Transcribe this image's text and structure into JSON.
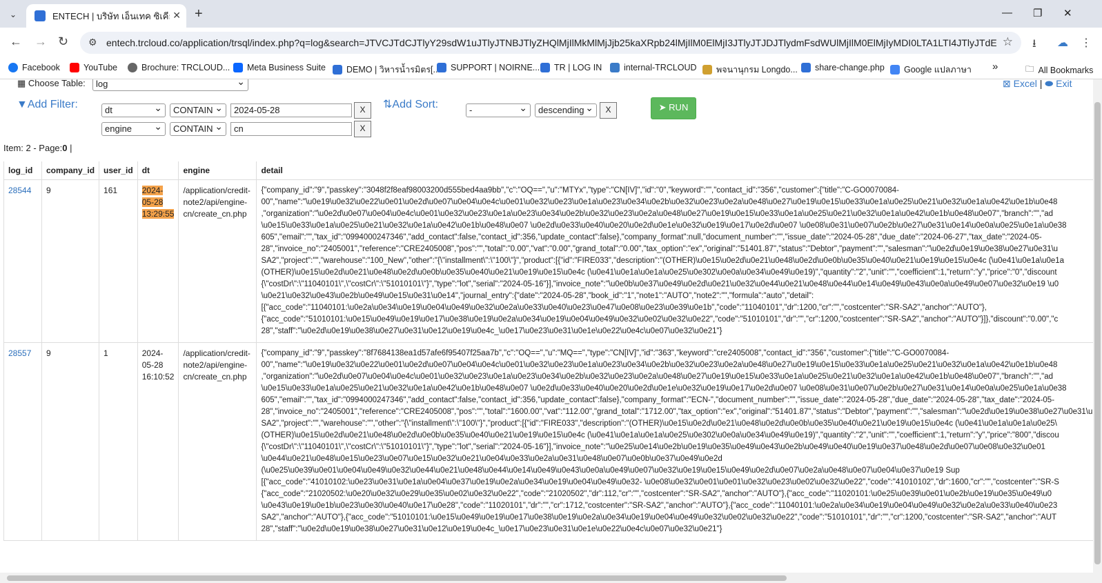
{
  "browser": {
    "tab_title": "ENTECH | บริษัท เอ็นเทค ซิเคียวริตี้",
    "url": "entech.trcloud.co/application/trsql/index.php?q=log&search=JTVCJTdCJTlyY29sdW1uJTlyJTNBJTlyZHQlMjIlMkMlMjJjb25kaXRpb24lMjIlM0ElMjI3JTlyJTJDJTlydmFsdWUlMjIlM0ElMjIyMDI0LTA1LTI4JTlyJTdEJTJD..."
  },
  "bookmarks": [
    {
      "label": "Facebook",
      "color": "#1877f2"
    },
    {
      "label": "YouTube",
      "color": "#ff0000"
    },
    {
      "label": "Brochure: TRCLOUD...",
      "color": "#555555"
    },
    {
      "label": "Meta Business Suite",
      "color": "#0a66ff"
    },
    {
      "label": "DEMO | วิหารน้ำรมิตร[...",
      "color": "#2f6fd6"
    },
    {
      "label": "SUPPORT | NOIRNE...",
      "color": "#2f6fd6"
    },
    {
      "label": "TR | LOG IN",
      "color": "#2f6fd6"
    },
    {
      "label": "internal-TRCLOUD",
      "color": "#3a7bc8"
    },
    {
      "label": "พจนานุกรม Longdo...",
      "color": "#d0a030"
    },
    {
      "label": "share-change.php",
      "color": "#2f6fd6"
    },
    {
      "label": "Google แปลภาษา",
      "color": "#4285f4"
    },
    {
      "label": "»",
      "color": ""
    },
    {
      "label": "All Bookmarks",
      "color": ""
    }
  ],
  "query": {
    "choose_table_label": "Choose Table:",
    "table_value": "log",
    "add_filter_label": "Add Filter:",
    "filters": [
      {
        "column": "dt",
        "op": "CONTAIN",
        "value": "2024-05-28",
        "remove": "X"
      },
      {
        "column": "engine",
        "op": "CONTAIN",
        "value": "cn",
        "remove": "X"
      }
    ],
    "add_sort_label": "Add Sort:",
    "sort": {
      "column": "-",
      "direction": "descending",
      "remove": "X"
    },
    "run_label": "RUN",
    "excel_label": "Excel",
    "exit_label": "Exit",
    "separator": "|"
  },
  "summary": {
    "prefix": "Item: 2 - Page:",
    "page": "0",
    "suffix": " |"
  },
  "table": {
    "headers": [
      "log_id",
      "company_id",
      "user_id",
      "dt",
      "engine",
      "detail"
    ],
    "rows": [
      {
        "log_id": "28544",
        "company_id": "9",
        "user_id": "161",
        "dt_date": "2024-\n05-28",
        "dt_time": "13:29:55",
        "engine": "/application/credit-\nnote2/api/engine-\ncn/create_cn.php",
        "detail": "{\"company_id\":\"9\",\"passkey\":\"3048f2f8eaf98003200d555bed4aa9bb\",\"c\":\"OQ==\",\"u\":\"MTYx\",\"type\":\"CN[IV]\",\"id\":\"0\",\"keyword\":\"\",\"contact_id\":\"356\",\"customer\":{\"title\":\"C-GO0070084-\n00\",\"name\":\"\\u0e19\\u0e32\\u0e22\\u0e01\\u0e2d\\u0e07\\u0e04\\u0e4c\\u0e01\\u0e32\\u0e23\\u0e1a\\u0e23\\u0e34\\u0e2b\\u0e32\\u0e23\\u0e2a\\u0e48\\u0e27\\u0e19\\u0e15\\u0e33\\u0e1a\\u0e25\\u0e21\\u0e32\\u0e1a\\u0e42\\u0e1b\\u0e48\n,\"organization\":\"\\u0e2d\\u0e07\\u0e04\\u0e4c\\u0e01\\u0e32\\u0e23\\u0e1a\\u0e23\\u0e34\\u0e2b\\u0e32\\u0e23\\u0e2a\\u0e48\\u0e27\\u0e19\\u0e15\\u0e33\\u0e1a\\u0e25\\u0e21\\u0e32\\u0e1a\\u0e42\\u0e1b\\u0e48\\u0e07\",\"branch\":\"\",\"ad\n\\u0e15\\u0e33\\u0e1a\\u0e25\\u0e21\\u0e32\\u0e1a\\u0e42\\u0e1b\\u0e48\\u0e07 \\u0e2d\\u0e33\\u0e40\\u0e20\\u0e2d\\u0e1e\\u0e32\\u0e19\\u0e17\\u0e2d\\u0e07 \\u0e08\\u0e31\\u0e07\\u0e2b\\u0e27\\u0e31\\u0e14\\u0e0a\\u0e25\\u0e1a\\u0e38\n605\",\"email\":\"\",\"tax_id\":\"0994000247346\",\"add_contact\":false,\"contact_id\":356,\"update_contact\":false},\"company_format\":null,\"document_number\":\"\",\"issue_date\":\"2024-05-28\",\"due_date\":\"2024-06-27\",\"tax_date\":\"2024-05-\n28\",\"invoice_no\":\"2405001\",\"reference\":\"CRE2405008\",\"pos\":\"\",\"total\":\"0.00\",\"vat\":\"0.00\",\"grand_total\":\"0.00\",\"tax_option\":\"ex\",\"original\":\"51401.87\",\"status\":\"Debtor\",\"payment\":\"\",\"salesman\":\"\\u0e2d\\u0e19\\u0e38\\u0e27\\u0e31\\u\nSA2\",\"project\":\"\",\"warehouse\":\"100_New\",\"other\":\"{\\\"installment\\\":\\\"100\\\"}\",\"product\":[{\"id\":\"FIRE033\",\"description\":\"(OTHER)\\u0e15\\u0e2d\\u0e21\\u0e48\\u0e2d\\u0e0b\\u0e35\\u0e40\\u0e21\\u0e19\\u0e15\\u0e4c (\\u0e41\\u0e1a\\u0e1a\n(OTHER)\\u0e15\\u0e2d\\u0e21\\u0e48\\u0e2d\\u0e0b\\u0e35\\u0e40\\u0e21\\u0e19\\u0e15\\u0e4c (\\u0e41\\u0e1a\\u0e1a\\u0e25\\u0e302\\u0e0a\\u0e34\\u0e49\\u0e19)\",\"quantity\":\"2\",\"unit\":\"\",\"coefficient\":1,\"return\":\"y\",\"price\":\"0\",\"discount\n{\\\"costDr\\\":\\\"11040101\\\",\\\"costCr\\\":\\\"51010101\\\"}\",\"type\":\"lot\",\"serial\":\"2024-05-16\"}],\"invoice_note\":\"\\u0e0b\\u0e37\\u0e49\\u0e2d\\u0e21\\u0e32\\u0e44\\u0e21\\u0e48\\u0e44\\u0e14\\u0e49\\u0e43\\u0e0a\\u0e49\\u0e07\\u0e32\\u0e19 \\u0\n\\u0e21\\u0e32\\u0e43\\u0e2b\\u0e49\\u0e15\\u0e31\\u0e14\",\"journal_entry\":{\"date\":\"2024-05-28\",\"book_id\":\"1\",\"note1\":\"AUTO\",\"note2\":\"\",\"formula\":\"auto\",\"detail\":\n[{\"acc_code\":\"11040101:\\u0e2a\\u0e34\\u0e19\\u0e04\\u0e49\\u0e32\\u0e2a\\u0e33\\u0e40\\u0e23\\u0e47\\u0e08\\u0e23\\u0e39\\u0e1b\",\"code\":\"11040101\",\"dr\":1200,\"cr\":\"\",\"costcenter\":\"SR-SA2\",\"anchor\":\"AUTO\"},\n{\"acc_code\":\"51010101:\\u0e15\\u0e49\\u0e19\\u0e17\\u0e38\\u0e19\\u0e2a\\u0e34\\u0e19\\u0e04\\u0e49\\u0e32\\u0e02\\u0e32\\u0e22\",\"code\":\"51010101\",\"dr\":\"\",\"cr\":1200,\"costcenter\":\"SR-SA2\",\"anchor\":\"AUTO\"}]},\"discount\":\"0.00\",\"c\n28\",\"staff\":\"\\u0e2d\\u0e19\\u0e38\\u0e27\\u0e31\\u0e12\\u0e19\\u0e4c_\\u0e17\\u0e23\\u0e31\\u0e1e\\u0e22\\u0e4c\\u0e07\\u0e32\\u0e21\"}"
      },
      {
        "log_id": "28557",
        "company_id": "9",
        "user_id": "1",
        "dt_date": "2024-\n05-28",
        "dt_time": "16:10:52",
        "engine": "/application/credit-\nnote2/api/engine-\ncn/create_cn.php",
        "detail": "{\"company_id\":\"9\",\"passkey\":\"8f7684138ea1d57afe6f95407f25aa7b\",\"c\":\"OQ==\",\"u\":\"MQ==\",\"type\":\"CN[IV]\",\"id\":\"363\",\"keyword\":\"cre2405008\",\"contact_id\":\"356\",\"customer\":{\"title\":\"C-GO0070084-\n00\",\"name\":\"\\u0e19\\u0e32\\u0e22\\u0e01\\u0e2d\\u0e07\\u0e04\\u0e4c\\u0e01\\u0e32\\u0e23\\u0e1a\\u0e23\\u0e34\\u0e2b\\u0e32\\u0e23\\u0e2a\\u0e48\\u0e27\\u0e19\\u0e15\\u0e33\\u0e1a\\u0e25\\u0e21\\u0e32\\u0e1a\\u0e42\\u0e1b\\u0e48\n,\"organization\":\"\\u0e2d\\u0e07\\u0e04\\u0e4c\\u0e01\\u0e32\\u0e23\\u0e1a\\u0e23\\u0e34\\u0e2b\\u0e32\\u0e23\\u0e2a\\u0e48\\u0e27\\u0e19\\u0e15\\u0e33\\u0e1a\\u0e25\\u0e21\\u0e32\\u0e1a\\u0e42\\u0e1b\\u0e48\\u0e07\",\"branch\":\"\",\"ad\n\\u0e15\\u0e33\\u0e1a\\u0e25\\u0e21\\u0e32\\u0e1a\\u0e42\\u0e1b\\u0e48\\u0e07 \\u0e2d\\u0e33\\u0e40\\u0e20\\u0e2d\\u0e1e\\u0e32\\u0e19\\u0e17\\u0e2d\\u0e07 \\u0e08\\u0e31\\u0e07\\u0e2b\\u0e27\\u0e31\\u0e14\\u0e0a\\u0e25\\u0e1a\\u0e38\n605\",\"email\":\"\",\"tax_id\":\"0994000247346\",\"add_contact\":false,\"contact_id\":356,\"update_contact\":false},\"company_format\":\"ECN-\",\"document_number\":\"\",\"issue_date\":\"2024-05-28\",\"due_date\":\"2024-05-28\",\"tax_date\":\"2024-05-\n28\",\"invoice_no\":\"2405001\",\"reference\":\"CRE2405008\",\"pos\":\"\",\"total\":\"1600.00\",\"vat\":\"112.00\",\"grand_total\":\"1712.00\",\"tax_option\":\"ex\",\"original\":\"51401.87\",\"status\":\"Debtor\",\"payment\":\"\",\"salesman\":\"\\u0e2d\\u0e19\\u0e38\\u0e27\\u0e31\\u\nSA2\",\"project\":\"\",\"warehouse\":\"\",\"other\":\"{\\\"installment\\\":\\\"100\\\"}\",\"product\":[{\"id\":\"FIRE033\",\"description\":\"(OTHER)\\u0e15\\u0e2d\\u0e21\\u0e48\\u0e2d\\u0e0b\\u0e35\\u0e40\\u0e21\\u0e19\\u0e15\\u0e4c (\\u0e41\\u0e1a\\u0e1a\\u0e25\\\n(OTHER)\\u0e15\\u0e2d\\u0e21\\u0e48\\u0e2d\\u0e0b\\u0e35\\u0e40\\u0e21\\u0e19\\u0e15\\u0e4c (\\u0e41\\u0e1a\\u0e1a\\u0e25\\u0e302\\u0e0a\\u0e34\\u0e49\\u0e19)\",\"quantity\":\"2\",\"unit\":\"\",\"coefficient\":1,\"return\":\"y\",\"price\":\"800\",\"discou\n{\\\"costDr\\\":\\\"11040101\\\",\\\"costCr\\\":\\\"51010101\\\"}\",\"type\":\"lot\",\"serial\":\"2024-05-16\"}],\"invoice_note\":\"\\u0e25\\u0e14\\u0e2b\\u0e19\\u0e35\\u0e49\\u0e43\\u0e2b\\u0e49\\u0e40\\u0e19\\u0e37\\u0e48\\u0e2d\\u0e07\\u0e08\\u0e32\\u0e01\n\\u0e44\\u0e21\\u0e48\\u0e15\\u0e23\\u0e07\\u0e15\\u0e32\\u0e21\\u0e04\\u0e33\\u0e2a\\u0e31\\u0e48\\u0e07\\u0e0b\\u0e37\\u0e49\\u0e2d\n(\\u0e25\\u0e39\\u0e01\\u0e04\\u0e49\\u0e32\\u0e44\\u0e21\\u0e48\\u0e44\\u0e14\\u0e49\\u0e43\\u0e0a\\u0e49\\u0e07\\u0e32\\u0e19\\u0e15\\u0e49\\u0e2d\\u0e07\\u0e2a\\u0e48\\u0e07\\u0e04\\u0e37\\u0e19 Sup\n[{\"acc_code\":\"41010102:\\u0e23\\u0e31\\u0e1a\\u0e04\\u0e37\\u0e19\\u0e2a\\u0e34\\u0e19\\u0e04\\u0e49\\u0e32- \\u0e08\\u0e32\\u0e01\\u0e01\\u0e32\\u0e23\\u0e02\\u0e32\\u0e22\",\"code\":\"41010102\",\"dr\":1600,\"cr\":\"\",\"costcenter\":\"SR-S\n{\"acc_code\":\"21020502:\\u0e20\\u0e32\\u0e29\\u0e35\\u0e02\\u0e32\\u0e22\",\"code\":\"21020502\",\"dr\":112,\"cr\":\"\",\"costcenter\":\"SR-SA2\",\"anchor\":\"AUTO\"},{\"acc_code\":\"11020101:\\u0e25\\u0e39\\u0e01\\u0e2b\\u0e19\\u0e35\\u0e49\\u0\n\\u0e43\\u0e19\\u0e1b\\u0e23\\u0e30\\u0e40\\u0e17\\u0e28\",\"code\":\"11020101\",\"dr\":\"\",\"cr\":1712,\"costcenter\":\"SR-SA2\",\"anchor\":\"AUTO\"},{\"acc_code\":\"11040101:\\u0e2a\\u0e34\\u0e19\\u0e04\\u0e49\\u0e32\\u0e2a\\u0e33\\u0e40\\u0e23\nSA2\",\"anchor\":\"AUTO\"},{\"acc_code\":\"51010101:\\u0e15\\u0e49\\u0e19\\u0e17\\u0e38\\u0e19\\u0e2a\\u0e34\\u0e19\\u0e04\\u0e49\\u0e32\\u0e02\\u0e32\\u0e22\",\"code\":\"51010101\",\"dr\":\"\",\"cr\":1200,\"costcenter\":\"SR-SA2\",\"anchor\":\"AUT\n28\",\"staff\":\"\\u0e2d\\u0e19\\u0e38\\u0e27\\u0e31\\u0e12\\u0e19\\u0e4c_\\u0e17\\u0e23\\u0e31\\u0e1e\\u0e22\\u0e4c\\u0e07\\u0e32\\u0e21\"}"
      }
    ]
  }
}
